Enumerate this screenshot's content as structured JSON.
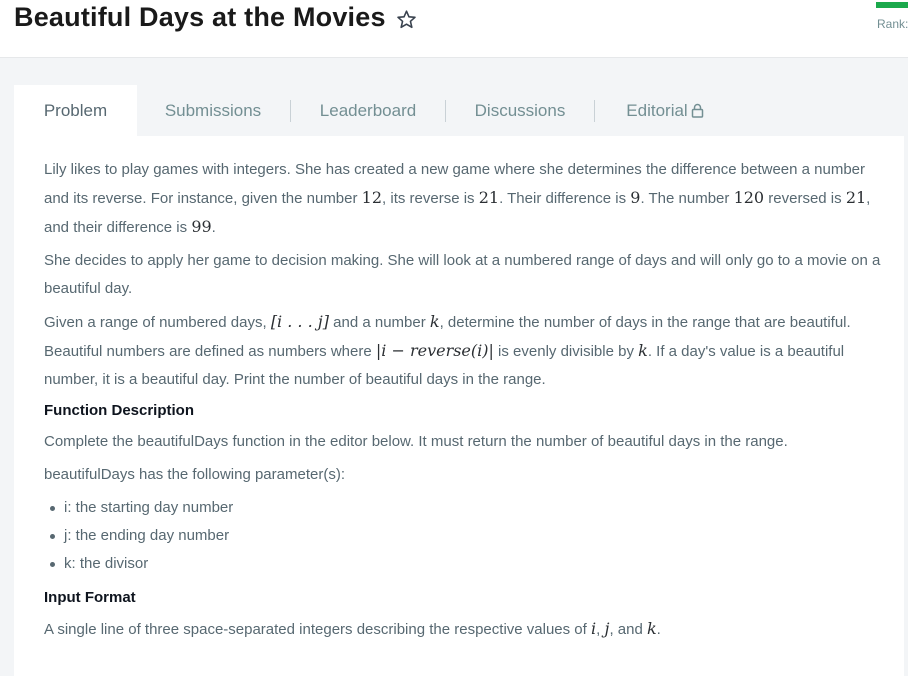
{
  "header": {
    "title": "Beautiful Days at the Movies",
    "rank_label": "Rank:",
    "star_icon": "star-outline-icon",
    "accent_color": "#1ba94c"
  },
  "tabs": [
    {
      "label": "Problem",
      "active": true
    },
    {
      "label": "Submissions",
      "active": false
    },
    {
      "label": "Leaderboard",
      "active": false
    },
    {
      "label": "Discussions",
      "active": false
    },
    {
      "label": "Editorial",
      "active": false,
      "icon": "lock-icon"
    }
  ],
  "problem": {
    "p1": {
      "a": "Lily likes to play games with integers. She has created a new game where she determines the difference between a number and its reverse. For instance, given the number ",
      "n1": "12",
      "b": ", its reverse is ",
      "n2": "21",
      "c": ". Their difference is ",
      "n3": "9",
      "d": ". The number ",
      "n4": "120",
      "e": " reversed is ",
      "n5": "21",
      "f": ", and their difference is ",
      "n6": "99",
      "g": "."
    },
    "p2": "She decides to apply her game to decision making. She will look at a numbered range of days and will only go to a movie on a beautiful day.",
    "p3": {
      "a": "Given a range of numbered days, ",
      "m1": "[i . . . j]",
      "b": " and a number ",
      "m2": "k",
      "c": ", determine the number of days in the range that are beautiful. Beautiful numbers are defined as numbers where ",
      "m3": "|i − reverse(i)|",
      "d": " is evenly divisible by ",
      "m4": "k",
      "e": ". If a day's value is a beautiful number, it is a beautiful day. Print the number of beautiful days in the range."
    },
    "function_description_heading": "Function Description",
    "function_description": "Complete the beautifulDays function in the editor below. It must return the number of beautiful days in the range.",
    "params_intro": "beautifulDays has the following parameter(s):",
    "params": [
      "i: the starting day number",
      "j: the ending day number",
      "k: the divisor"
    ],
    "input_format_heading": "Input Format",
    "input_format": {
      "a": "A single line of three space-separated integers describing the respective values of ",
      "m1": "i",
      "b": ", ",
      "m2": "j",
      "c": ", and ",
      "m3": "k",
      "d": "."
    }
  }
}
